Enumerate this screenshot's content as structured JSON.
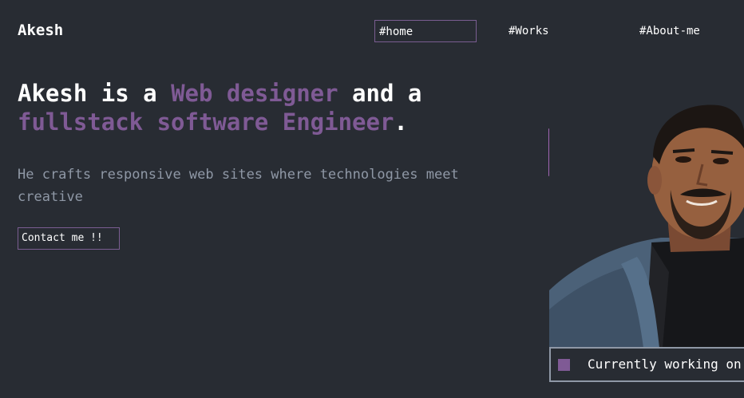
{
  "header": {
    "logo": "Akesh",
    "nav": [
      {
        "label": "#home"
      },
      {
        "label": "#Works"
      },
      {
        "label": "#About-me"
      }
    ]
  },
  "hero": {
    "headline": {
      "part1": "Akesh is a ",
      "accent1": "Web designer",
      "part2": " and a ",
      "accent2": "fullstack software Engineer",
      "part3": "."
    },
    "subtitle": "He crafts responsive web sites where technologies meet creative",
    "contact_button": "Contact me !!"
  },
  "status": {
    "text": "Currently working on p"
  },
  "colors": {
    "background": "#282c33",
    "accent": "#7f5a95",
    "muted_text": "#8f98a6",
    "text": "#ffffff"
  },
  "icons": {
    "decoration": "overlapping-squares-icon"
  }
}
